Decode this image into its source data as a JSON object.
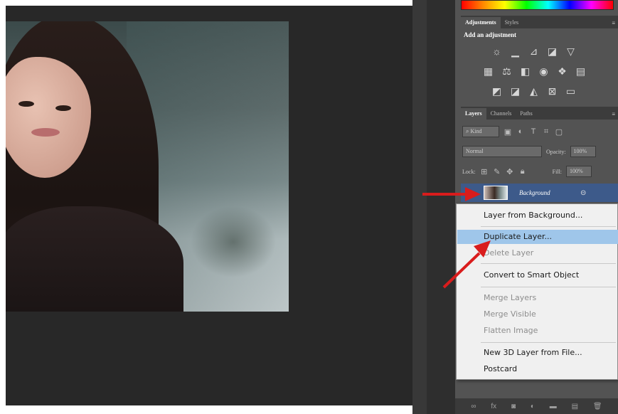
{
  "adjustments_panel": {
    "tabs": [
      "Adjustments",
      "Styles"
    ],
    "menu_glyph": "≡",
    "title": "Add an adjustment",
    "row1_icons": [
      "brightness-contrast-icon",
      "levels-icon",
      "curves-icon",
      "exposure-icon",
      "vibrance-icon"
    ],
    "row2_icons": [
      "hue-saturation-icon",
      "color-balance-icon",
      "black-white-icon",
      "photo-filter-icon",
      "channel-mixer-icon",
      "color-lookup-icon"
    ],
    "row3_icons": [
      "invert-icon",
      "posterize-icon",
      "threshold-icon",
      "selective-color-icon",
      "gradient-map-icon"
    ]
  },
  "layers_panel": {
    "tabs": [
      "Layers",
      "Channels",
      "Paths"
    ],
    "menu_glyph": "≡",
    "filter_kind": "Kind",
    "blend_mode": "Normal",
    "opacity_label": "Opacity:",
    "opacity_value": "100%",
    "lock_label": "Lock:",
    "fill_label": "Fill:",
    "fill_value": "100%",
    "layer_name": "Background"
  },
  "context_menu": {
    "items": [
      {
        "label": "Layer from Background...",
        "state": "normal"
      },
      {
        "label": "Duplicate Layer...",
        "state": "highlighted"
      },
      {
        "label": "Delete Layer",
        "state": "disabled"
      },
      {
        "label": "Convert to Smart Object",
        "state": "normal"
      },
      {
        "label": "Merge Layers",
        "state": "disabled"
      },
      {
        "label": "Merge Visible",
        "state": "disabled"
      },
      {
        "label": "Flatten Image",
        "state": "disabled"
      },
      {
        "label": "New 3D Layer from File...",
        "state": "normal"
      },
      {
        "label": "Postcard",
        "state": "normal"
      }
    ]
  },
  "annotations": {
    "arrow_color": "#d91c1c",
    "highlight_color": "#9fc6ea",
    "selected_layer_color": "#3d5a8a"
  }
}
